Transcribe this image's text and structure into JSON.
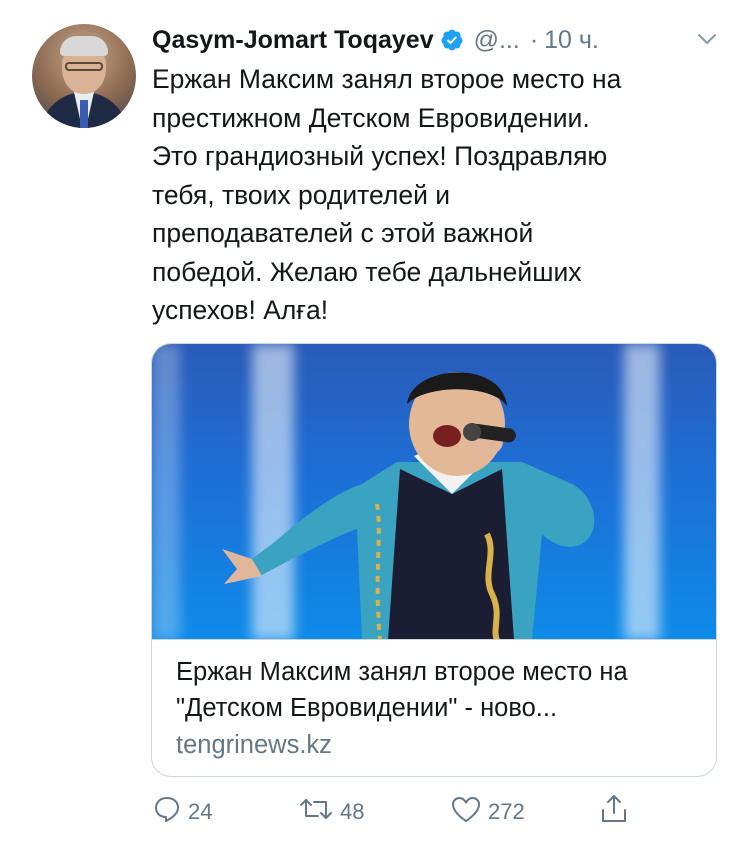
{
  "tweet": {
    "display_name": "Qasym-Jomart Toqayev",
    "handle": "@...",
    "dot": "·",
    "time": "10 ч.",
    "text": "Ержан Максим занял второе место на\nпрестижном Детском Евровидении.\nЭто грандиозный успех! Поздравляю\nтебя, твоих родителей и\nпреподавателей с этой важной\nпобедой. Желаю тебе дальнейших\nуспехов! Алға!"
  },
  "card": {
    "title": "Ержан Максим занял второе место на \"Детском Евровидении\" - ново...",
    "domain": "tengrinews.kz"
  },
  "actions": {
    "reply_count": "24",
    "retweet_count": "48",
    "like_count": "272"
  },
  "icons": {
    "verified": "verified-badge-icon",
    "caret": "chevron-down-icon",
    "reply": "reply-icon",
    "retweet": "retweet-icon",
    "like": "heart-icon",
    "share": "share-icon"
  },
  "colors": {
    "text": "#14171a",
    "secondary": "#657786",
    "verified": "#1da1f2",
    "border": "#ccd6dd"
  }
}
